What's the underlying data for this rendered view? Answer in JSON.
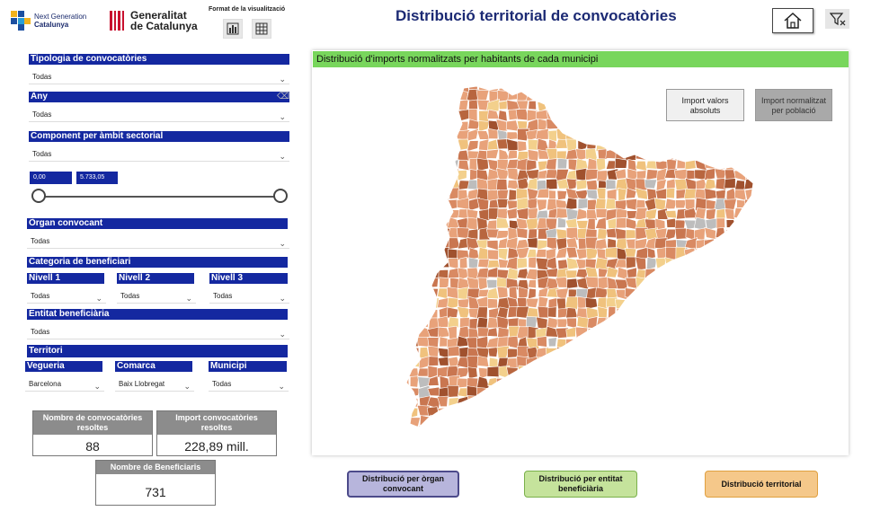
{
  "header": {
    "ngc_line1": "Next Generation",
    "ngc_line2": "Catalunya",
    "gen_line1": "Generalitat",
    "gen_line2": "de Catalunya",
    "format_label": "Format de la visualització",
    "title": "Distribució territorial de convocatòries"
  },
  "filters": {
    "tipologia": {
      "label": "Tipologia de convocatòries",
      "value": "Todas"
    },
    "any": {
      "label": "Any",
      "value": "Todas"
    },
    "component": {
      "label": "Component per àmbit sectorial",
      "value": "Todas"
    },
    "range": {
      "min": "0,00",
      "max": "5.733,05"
    },
    "organ": {
      "label": "Òrgan convocant",
      "value": "Todas"
    },
    "categoria": {
      "label": "Categoria de beneficiari"
    },
    "nivell1": {
      "label": "Nivell 1",
      "value": "Todas"
    },
    "nivell2": {
      "label": "Nivell 2",
      "value": "Todas"
    },
    "nivell3": {
      "label": "Nivell 3",
      "value": "Todas"
    },
    "entitat": {
      "label": "Entitat beneficiària",
      "value": "Todas"
    },
    "territori": {
      "label": "Territori"
    },
    "vegueria": {
      "label": "Vegueria",
      "value": "Barcelona"
    },
    "comarca": {
      "label": "Comarca",
      "value": "Baix Llobregat"
    },
    "municipi": {
      "label": "Municipi",
      "value": "Todas"
    }
  },
  "kpis": {
    "convocatories": {
      "label": "Nombre de convocatòries resoltes",
      "value": "88"
    },
    "import": {
      "label": "Import convocatòries resoltes",
      "value": "228,89 mill."
    },
    "beneficiaris": {
      "label": "Nombre de Beneficiaris",
      "value": "731"
    }
  },
  "map": {
    "title": "Distribució d'imports normalitzats per habitants de cada municipi",
    "btn_absolute": "Import valors absoluts",
    "btn_normalized": "Import normalitzat per població",
    "colors": [
      "#e8a27a",
      "#d98a63",
      "#c97650",
      "#f0c27d",
      "#b8663f",
      "#a0512e",
      "#bdbdbd",
      "#f3d08c"
    ]
  },
  "nav": {
    "organ": "Distribució per òrgan convocant",
    "entitat": "Distribució per entitat beneficiària",
    "territorial": "Distribució territorial"
  }
}
